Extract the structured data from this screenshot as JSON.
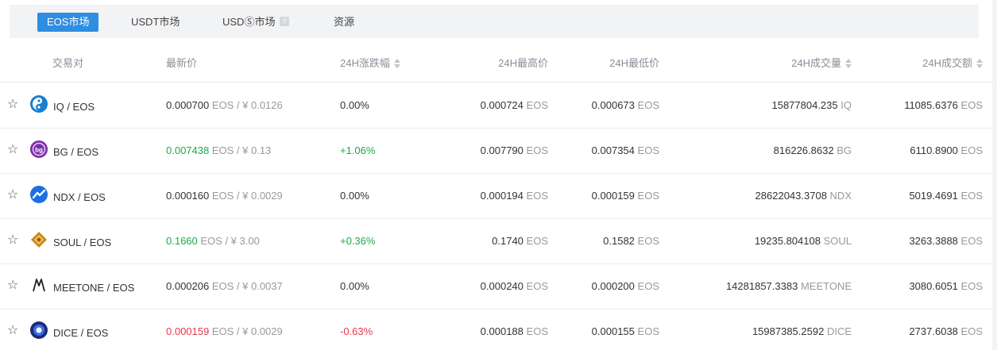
{
  "tabs": [
    {
      "label": "EOS市场"
    },
    {
      "label": "USDT市场"
    },
    {
      "label": "USDⓈ市场"
    },
    {
      "label": "资源"
    }
  ],
  "columns": {
    "pair": "交易对",
    "price": "最新价",
    "change": "24H涨跌幅",
    "high": "24H最高价",
    "low": "24H最低价",
    "volume": "24H成交量",
    "turnover": "24H成交额"
  },
  "rows": [
    {
      "icon": "iq-coin-icon",
      "pair": "IQ / EOS",
      "price": "0.000700",
      "price_unit": "EOS / ¥ 0.0126",
      "change": "0.00%",
      "trend": "flat",
      "high": "0.000724",
      "high_unit": "EOS",
      "low": "0.000673",
      "low_unit": "EOS",
      "volume": "15877804.235",
      "volume_unit": "IQ",
      "turnover": "11085.6376",
      "turnover_unit": "EOS"
    },
    {
      "icon": "bg-coin-icon",
      "pair": "BG / EOS",
      "price": "0.007438",
      "price_unit": "EOS / ¥ 0.13",
      "change": "+1.06%",
      "trend": "up",
      "high": "0.007790",
      "high_unit": "EOS",
      "low": "0.007354",
      "low_unit": "EOS",
      "volume": "816226.8632",
      "volume_unit": "BG",
      "turnover": "6110.8900",
      "turnover_unit": "EOS"
    },
    {
      "icon": "ndx-coin-icon",
      "pair": "NDX / EOS",
      "price": "0.000160",
      "price_unit": "EOS / ¥ 0.0029",
      "change": "0.00%",
      "trend": "flat",
      "high": "0.000194",
      "high_unit": "EOS",
      "low": "0.000159",
      "low_unit": "EOS",
      "volume": "28622043.3708",
      "volume_unit": "NDX",
      "turnover": "5019.4691",
      "turnover_unit": "EOS"
    },
    {
      "icon": "soul-coin-icon",
      "pair": "SOUL / EOS",
      "price": "0.1660",
      "price_unit": "EOS / ¥ 3.00",
      "change": "+0.36%",
      "trend": "up",
      "high": "0.1740",
      "high_unit": "EOS",
      "low": "0.1582",
      "low_unit": "EOS",
      "volume": "19235.804108",
      "volume_unit": "SOUL",
      "turnover": "3263.3888",
      "turnover_unit": "EOS"
    },
    {
      "icon": "meetone-coin-icon",
      "pair": "MEETONE / EOS",
      "price": "0.000206",
      "price_unit": "EOS / ¥ 0.0037",
      "change": "0.00%",
      "trend": "flat",
      "high": "0.000240",
      "high_unit": "EOS",
      "low": "0.000200",
      "low_unit": "EOS",
      "volume": "14281857.3383",
      "volume_unit": "MEETONE",
      "turnover": "3080.6051",
      "turnover_unit": "EOS"
    },
    {
      "icon": "dice-coin-icon",
      "pair": "DICE / EOS",
      "price": "0.000159",
      "price_unit": "EOS / ¥ 0.0029",
      "change": "-0.63%",
      "trend": "down",
      "high": "0.000188",
      "high_unit": "EOS",
      "low": "0.000155",
      "low_unit": "EOS",
      "volume": "15987385.2592",
      "volume_unit": "DICE",
      "turnover": "2737.6038",
      "turnover_unit": "EOS"
    }
  ],
  "colors": {
    "accent": "#2f8ee0",
    "up": "#1fa84a",
    "down": "#e8384f"
  }
}
